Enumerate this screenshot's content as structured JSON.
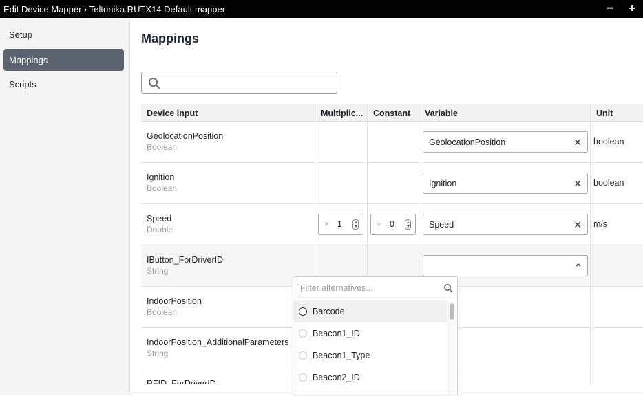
{
  "window": {
    "title": "Edit Device Mapper › Teltonika RUTX14 Default mapper",
    "minimize_label": "−",
    "maximize_label": "+"
  },
  "sidebar": {
    "items": [
      {
        "label": "Setup",
        "active": false
      },
      {
        "label": "Mappings",
        "active": true
      },
      {
        "label": "Scripts",
        "active": false
      }
    ]
  },
  "main": {
    "title": "Mappings",
    "search": {
      "value": "",
      "placeholder": ""
    }
  },
  "table": {
    "columns": [
      "Device input",
      "Multiplic...",
      "Constant",
      "Variable",
      "Unit"
    ],
    "rows": [
      {
        "name": "GeolocationPosition",
        "type": "Boolean",
        "variable": "GeolocationPosition",
        "unit": "boolean"
      },
      {
        "name": "Ignition",
        "type": "Boolean",
        "variable": "Ignition",
        "unit": "boolean"
      },
      {
        "name": "Speed",
        "type": "Double",
        "multiplier_op": "×",
        "multiplier": "1",
        "constant_op": "+",
        "constant": "0",
        "variable": "Speed",
        "unit": "m/s"
      },
      {
        "name": "IButton_ForDriverID",
        "type": "String",
        "variable": "",
        "unit": ""
      },
      {
        "name": "IndoorPosition",
        "type": "Boolean",
        "variable": "",
        "unit": ""
      },
      {
        "name": "IndoorPosition_AdditionalParameters",
        "type": "String",
        "variable": "",
        "unit": ""
      },
      {
        "name": "RFID_ForDriverID",
        "type": "",
        "variable": "",
        "unit": ""
      }
    ]
  },
  "dropdown": {
    "filter_placeholder": "Filter alternatives...",
    "options": [
      "Barcode",
      "Beacon1_ID",
      "Beacon1_Type",
      "Beacon2_ID"
    ]
  },
  "colors": {
    "active_nav": "#5b646e",
    "titlebar": "#000000"
  }
}
